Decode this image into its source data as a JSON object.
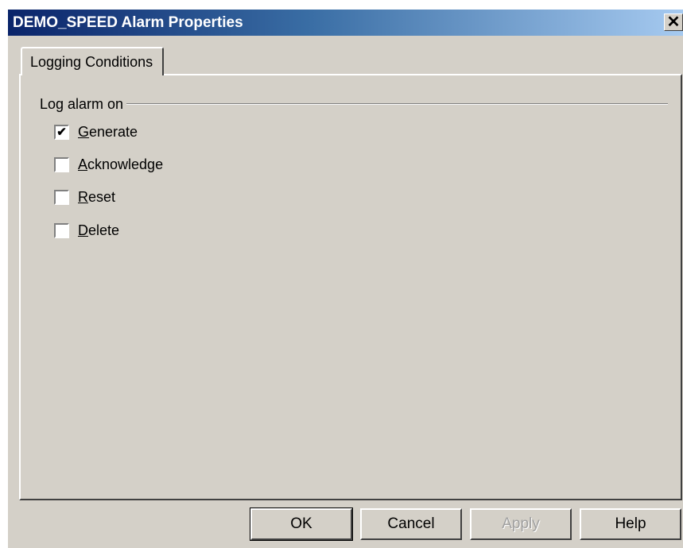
{
  "window": {
    "title": "DEMO_SPEED Alarm Properties",
    "close_glyph": "✕"
  },
  "tabs": [
    {
      "label": "Logging Conditions",
      "active": true
    }
  ],
  "group": {
    "label": "Log alarm on"
  },
  "options": [
    {
      "label": "Generate",
      "checked": true
    },
    {
      "label": "Acknowledge",
      "checked": false
    },
    {
      "label": "Reset",
      "checked": false
    },
    {
      "label": "Delete",
      "checked": false
    }
  ],
  "buttons": {
    "ok": "OK",
    "cancel": "Cancel",
    "apply": "Apply",
    "help": "Help"
  },
  "colors": {
    "face": "#d4d0c8",
    "title_start": "#0a246a",
    "title_end": "#a6caf0"
  }
}
